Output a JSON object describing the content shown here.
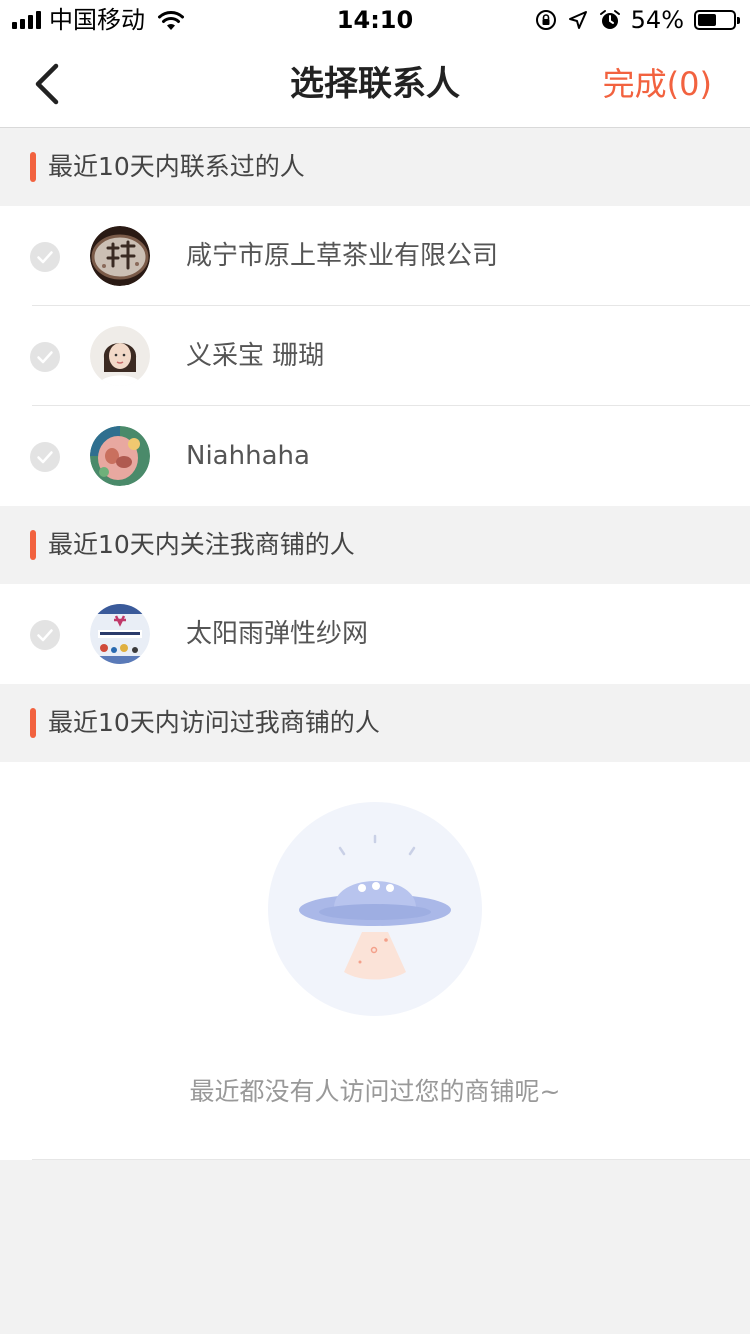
{
  "status_bar": {
    "carrier": "中国移动",
    "time": "14:10",
    "battery_percent": "54%",
    "battery_level": 0.54
  },
  "nav": {
    "title": "选择联系人",
    "done_label": "完成(0)",
    "accent_color": "#f2623f"
  },
  "sections": [
    {
      "title": "最近10天内联系过的人",
      "contacts": [
        {
          "name": "咸宁市原上草茶业有限公司",
          "avatar": "tea-logo-avatar",
          "selected": false
        },
        {
          "name": "义采宝 珊瑚",
          "avatar": "woman-portrait-avatar",
          "selected": false
        },
        {
          "name": "Niahhaha",
          "avatar": "colorful-photo-avatar",
          "selected": false
        }
      ]
    },
    {
      "title": "最近10天内关注我商铺的人",
      "contacts": [
        {
          "name": "太阳雨弹性纱网",
          "avatar": "shop-banner-avatar",
          "selected": false
        }
      ]
    },
    {
      "title": "最近10天内访问过我商铺的人",
      "contacts": [],
      "empty_text": "最近都没有人访问过您的商铺呢~",
      "empty_icon": "ufo-illustration"
    }
  ]
}
